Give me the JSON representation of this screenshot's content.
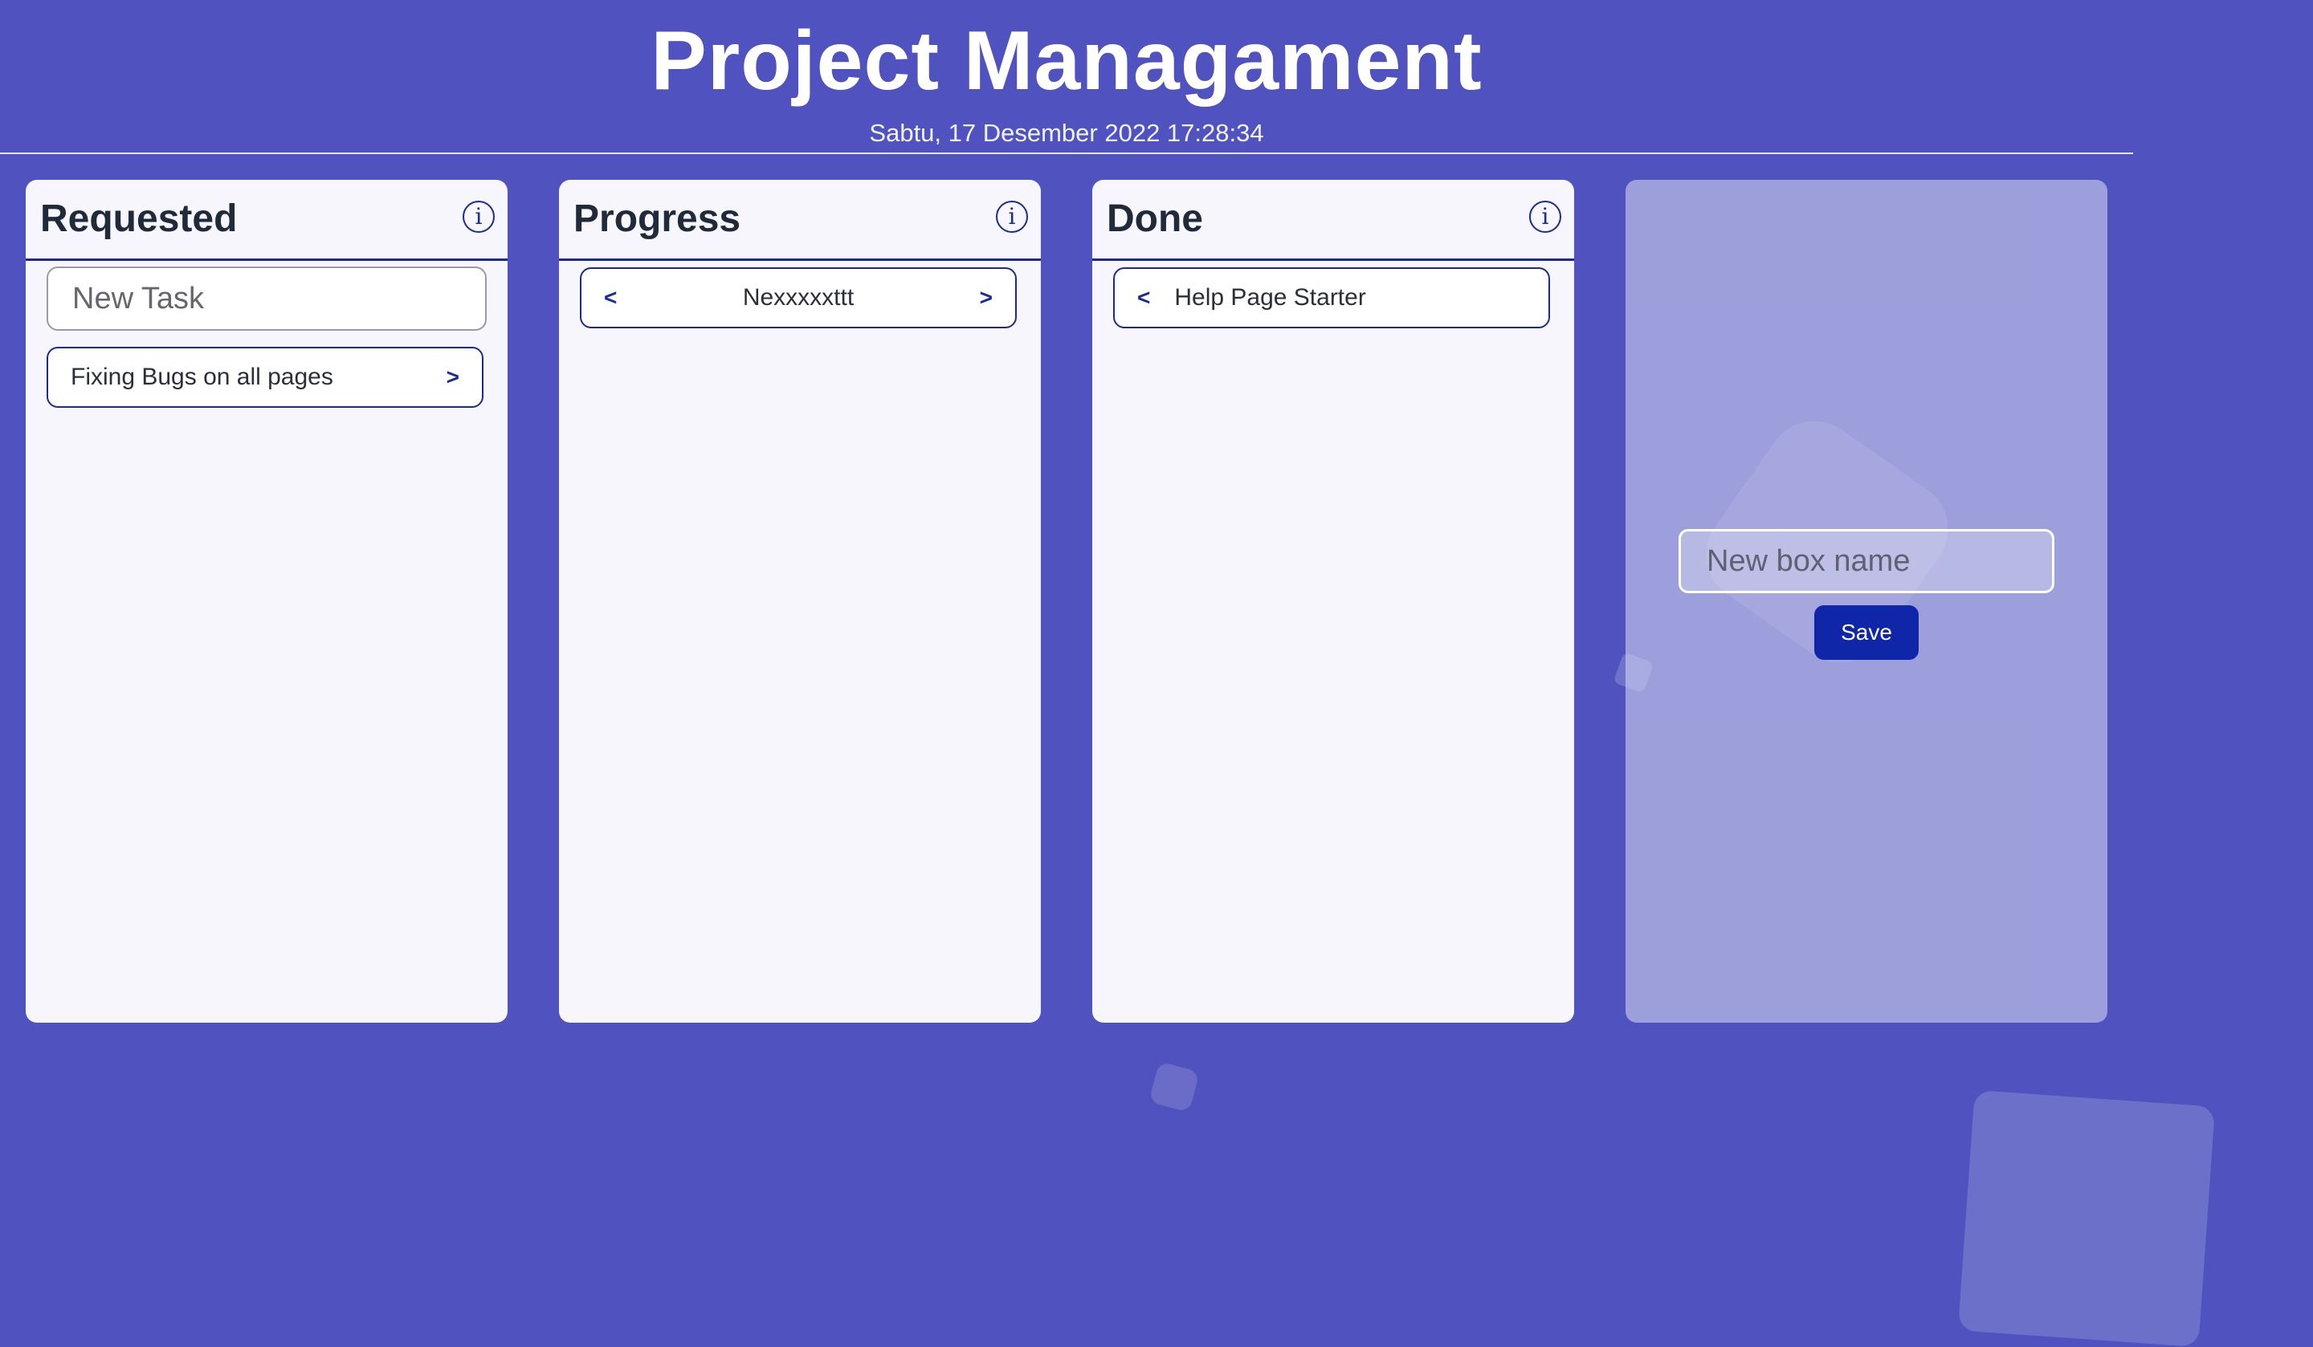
{
  "header": {
    "title": "Project Managament",
    "datetime": "Sabtu, 17 Desember 2022 17:28:34"
  },
  "columns": [
    {
      "title": "Requested",
      "info_icon": "info-icon",
      "new_task_placeholder": "New Task",
      "tasks": [
        {
          "text": "Fixing Bugs on all pages",
          "next": ">"
        }
      ]
    },
    {
      "title": "Progress",
      "info_icon": "info-icon",
      "tasks": [
        {
          "prev": "<",
          "text": "Nexxxxxttt",
          "next": ">"
        }
      ]
    },
    {
      "title": "Done",
      "info_icon": "info-icon",
      "tasks": [
        {
          "prev": "<",
          "text": "Help Page Starter"
        }
      ]
    }
  ],
  "new_box": {
    "placeholder": "New box name",
    "save_label": "Save"
  },
  "colors": {
    "background": "#5053bf",
    "accent": "#1a2a99",
    "save_button": "#0f26a8",
    "column_bg": "#f6f6fc"
  }
}
